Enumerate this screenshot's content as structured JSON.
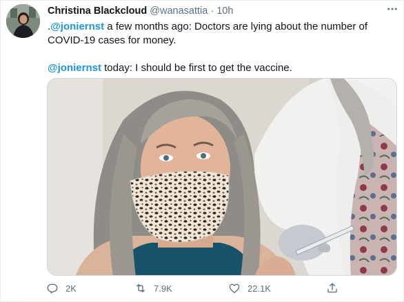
{
  "tweet": {
    "author_name": "Christina Blackcloud",
    "author_handle": "@wanasattia",
    "separator": "·",
    "time": "10h",
    "more_label": "•••",
    "line1_prefix": ".",
    "mention1": "@joniernst",
    "line1_text": " a few months ago: Doctors are lying about the number of COVID-19 cases for money.",
    "mention2": "@joniernst",
    "line2_text": " today: I should be first to get the vaccine."
  },
  "actions": {
    "reply_count": "2K",
    "retweet_count": "7.9K",
    "like_count": "22.1K"
  },
  "icons": {
    "reply": "reply-icon",
    "retweet": "retweet-icon",
    "like": "heart-icon",
    "share": "share-icon",
    "more": "more-icon"
  },
  "colors": {
    "link": "#1b95e0",
    "secondary_text": "#5b7083",
    "primary_text": "#0f1419"
  }
}
